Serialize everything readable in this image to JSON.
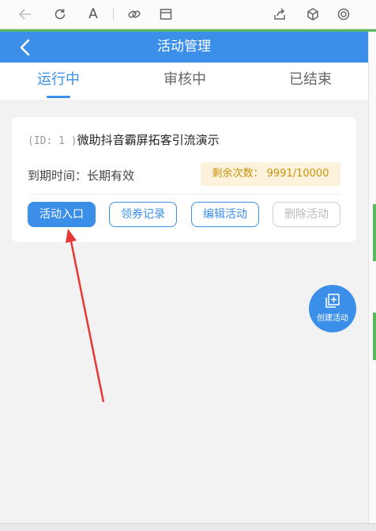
{
  "browser_toolbar": {
    "icons": [
      "back-arrow-icon",
      "refresh-icon",
      "font-icon",
      "link-icon",
      "window-icon",
      "share-icon",
      "cube-icon",
      "settings-circle-icon"
    ],
    "font_glyph": "A"
  },
  "header": {
    "title": "活动管理"
  },
  "tabs": [
    {
      "label": "运行中",
      "active": true
    },
    {
      "label": "审核中",
      "active": false
    },
    {
      "label": "已结束",
      "active": false
    }
  ],
  "activity_card": {
    "id_text": "(ID: 1 )",
    "name": "微助抖音霸屏拓客引流演示",
    "expire_text": "到期时间：长期有效",
    "remaining_text": "剩余次数： 9991/10000",
    "buttons": {
      "entry": "活动入口",
      "coupon_records": "领券记录",
      "edit": "编辑活动",
      "delete": "删除活动"
    }
  },
  "fab": {
    "label": "创建活动"
  },
  "colors": {
    "primary": "#3b8fe9",
    "accent_green": "#5cb85c",
    "remaining_bg": "#fdf3dc",
    "remaining_text": "#c9920d",
    "annotation_arrow": "#e53935"
  }
}
